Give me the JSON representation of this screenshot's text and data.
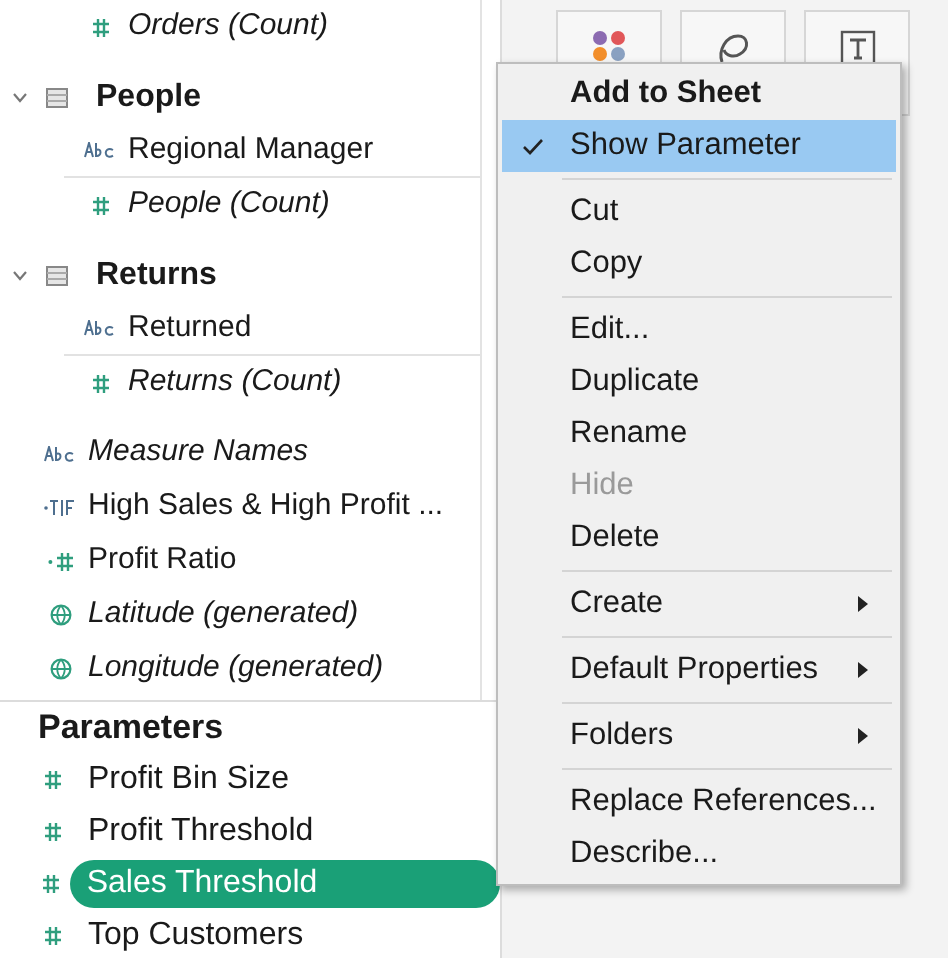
{
  "data_pane": {
    "items": [
      {
        "kind": "table_continued",
        "children": [
          {
            "name": "Orders (Count)",
            "kind": "measure",
            "generated": true
          }
        ]
      },
      {
        "kind": "table",
        "name": "People",
        "expanded": true,
        "children": [
          {
            "name": "Regional Manager",
            "kind": "dimension",
            "generated": false
          },
          {
            "name": "People (Count)",
            "kind": "measure",
            "generated": true
          }
        ]
      },
      {
        "kind": "table",
        "name": "Returns",
        "expanded": true,
        "children": [
          {
            "name": "Returned",
            "kind": "dimension",
            "generated": false
          },
          {
            "name": "Returns (Count)",
            "kind": "measure",
            "generated": true
          }
        ]
      },
      {
        "kind": "dimension",
        "name": "Measure Names",
        "generated": true
      },
      {
        "kind": "boolean_calc",
        "name": "High Sales & High Profit ...",
        "generated": false
      },
      {
        "kind": "measure_calc",
        "name": "Profit Ratio",
        "generated": false
      },
      {
        "kind": "geo",
        "name": "Latitude (generated)",
        "generated": true
      },
      {
        "kind": "geo",
        "name": "Longitude (generated)",
        "generated": true
      }
    ]
  },
  "parameters": {
    "title": "Parameters",
    "items": [
      {
        "name": "Profit Bin Size",
        "selected": false
      },
      {
        "name": "Profit Threshold",
        "selected": false
      },
      {
        "name": "Sales Threshold",
        "selected": true
      },
      {
        "name": "Top Customers",
        "selected": false
      }
    ]
  },
  "context_menu": {
    "groups": [
      [
        {
          "label": "Add to Sheet",
          "default": true,
          "checked": false,
          "selected": false,
          "disabled": false,
          "submenu": false
        },
        {
          "label": "Show Parameter",
          "default": false,
          "checked": true,
          "selected": true,
          "disabled": false,
          "submenu": false
        }
      ],
      [
        {
          "label": "Cut",
          "default": false,
          "checked": false,
          "selected": false,
          "disabled": false,
          "submenu": false
        },
        {
          "label": "Copy",
          "default": false,
          "checked": false,
          "selected": false,
          "disabled": false,
          "submenu": false
        }
      ],
      [
        {
          "label": "Edit...",
          "default": false,
          "checked": false,
          "selected": false,
          "disabled": false,
          "submenu": false
        },
        {
          "label": "Duplicate",
          "default": false,
          "checked": false,
          "selected": false,
          "disabled": false,
          "submenu": false
        },
        {
          "label": "Rename",
          "default": false,
          "checked": false,
          "selected": false,
          "disabled": false,
          "submenu": false
        },
        {
          "label": "Hide",
          "default": false,
          "checked": false,
          "selected": false,
          "disabled": true,
          "submenu": false
        },
        {
          "label": "Delete",
          "default": false,
          "checked": false,
          "selected": false,
          "disabled": false,
          "submenu": false
        }
      ],
      [
        {
          "label": "Create",
          "default": false,
          "checked": false,
          "selected": false,
          "disabled": false,
          "submenu": true
        }
      ],
      [
        {
          "label": "Default Properties",
          "default": false,
          "checked": false,
          "selected": false,
          "disabled": false,
          "submenu": true
        }
      ],
      [
        {
          "label": "Folders",
          "default": false,
          "checked": false,
          "selected": false,
          "disabled": false,
          "submenu": true
        }
      ],
      [
        {
          "label": "Replace References...",
          "default": false,
          "checked": false,
          "selected": false,
          "disabled": false,
          "submenu": false
        },
        {
          "label": "Describe...",
          "default": false,
          "checked": false,
          "selected": false,
          "disabled": false,
          "submenu": false
        }
      ]
    ]
  }
}
